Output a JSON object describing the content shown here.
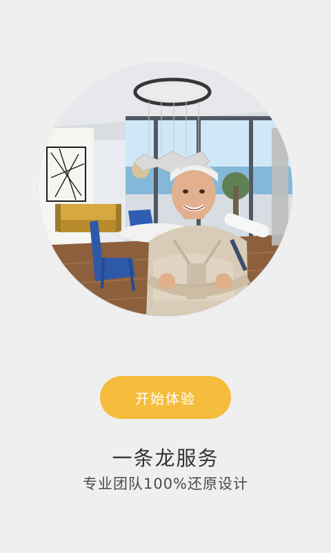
{
  "hero": {
    "image_alt": "worker in a modern apartment"
  },
  "cta": {
    "label": "开始体验"
  },
  "tagline": {
    "title": "一条龙服务",
    "subtitle": "专业团队100%还原设计"
  },
  "colors": {
    "background": "#efefef",
    "accent": "#f5bd3b",
    "title": "#333333",
    "subtitle": "#4a4a4a"
  }
}
